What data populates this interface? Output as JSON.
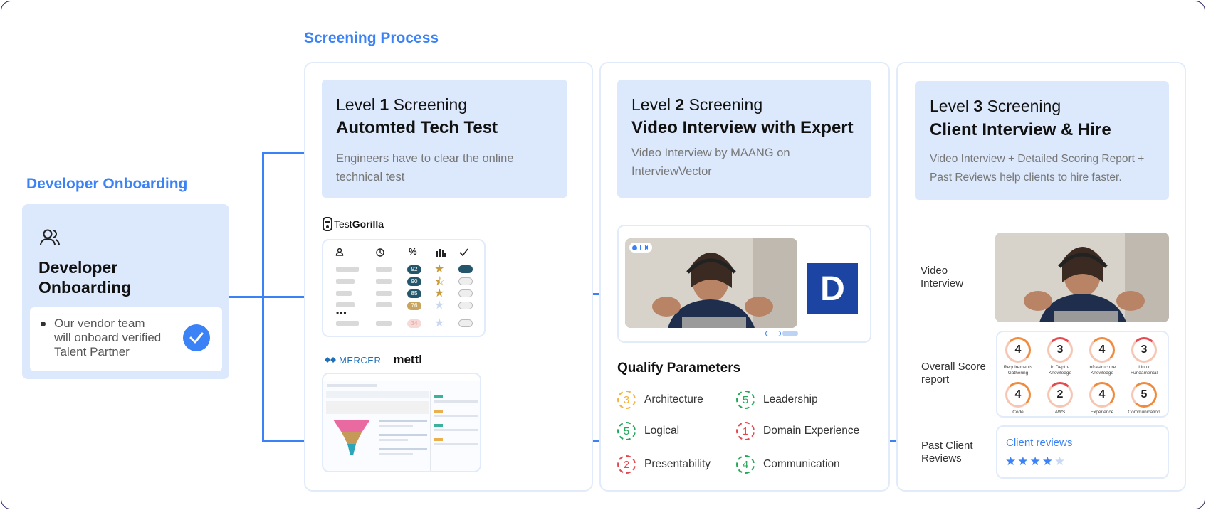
{
  "screening_title": "Screening Process",
  "onboarding": {
    "section_title": "Developer Onboarding",
    "card_title_line1": "Developer",
    "card_title_line2": "Onboarding",
    "note_line1": "Our vendor team",
    "note_line2": "will onboard verified",
    "note_line3": "Talent Partner"
  },
  "level1": {
    "prefix": "Level",
    "number": "1",
    "suffix": "Screening",
    "title": "Automted Tech Test",
    "desc_line1": "Engineers have to clear the online",
    "desc_line2": "technical test",
    "brand": "Test",
    "brand_bold": "Gorilla",
    "scores": [
      "92",
      "90",
      "85",
      "76",
      "34"
    ],
    "dots": "•••",
    "mercer_brand": "MERCER",
    "mettl_brand": "mettl"
  },
  "level2": {
    "prefix": "Level",
    "number": "2",
    "suffix": "Screening",
    "title": "Video Interview with Expert",
    "desc_line1": "Video Interview by MAANG on",
    "desc_line2": "InterviewVector",
    "logo_letter": "D",
    "qualify_title": "Qualify Parameters",
    "params": [
      {
        "score": "3",
        "label": "Architecture",
        "color": "#f4b342"
      },
      {
        "score": "5",
        "label": "Leadership",
        "color": "#22a85a"
      },
      {
        "score": "5",
        "label": "Logical",
        "color": "#22a85a"
      },
      {
        "score": "1",
        "label": "Domain Experience",
        "color": "#e5484d"
      },
      {
        "score": "2",
        "label": "Presentability",
        "color": "#e5484d"
      },
      {
        "score": "4",
        "label": "Communication",
        "color": "#22a85a"
      }
    ]
  },
  "level3": {
    "prefix": "Level",
    "number": "3",
    "suffix": "Screening",
    "title": "Client Interview & Hire",
    "desc_line1": "Video Interview + Detailed Scoring Report +",
    "desc_line2": "Past Reviews help clients to hire faster.",
    "video_label_line1": "Video",
    "video_label_line2": "Interview",
    "score_label_line1": "Overall Score",
    "score_label_line2": "report",
    "reviews_label_line1": "Past Client",
    "reviews_label_line2": "Reviews",
    "scores": [
      {
        "value": "4",
        "label_line1": "Requirements",
        "label_line2": "Gathering"
      },
      {
        "value": "3",
        "label_line1": "In Depth-",
        "label_line2": "Knowledge"
      },
      {
        "value": "4",
        "label_line1": "Infrastructure",
        "label_line2": "Knowledge"
      },
      {
        "value": "3",
        "label_line1": "Linux",
        "label_line2": "Fundamental"
      },
      {
        "value": "4",
        "label_line1": "Code",
        "label_line2": ""
      },
      {
        "value": "2",
        "label_line1": "AWS",
        "label_line2": ""
      },
      {
        "value": "4",
        "label_line1": "Experience",
        "label_line2": ""
      },
      {
        "value": "5",
        "label_line1": "Communication",
        "label_line2": ""
      }
    ],
    "reviews_title": "Client reviews",
    "rating": 4,
    "rating_max": 5
  },
  "colors": {
    "accent": "#3b82f6",
    "card_bg": "#dce8fb",
    "border": "#2f2a63"
  }
}
